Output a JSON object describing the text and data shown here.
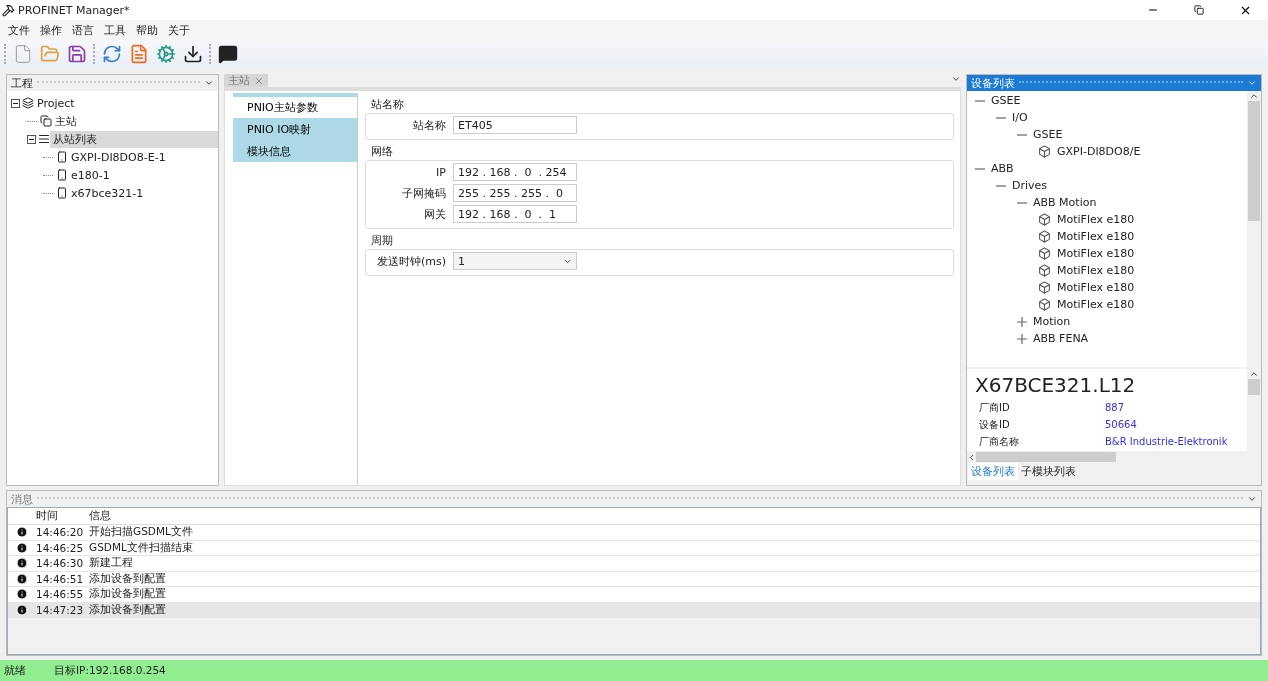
{
  "window": {
    "title": "PROFINET Manager*"
  },
  "menu": [
    "文件",
    "操作",
    "语言",
    "工具",
    "帮助",
    "关于"
  ],
  "project_panel": {
    "title": "工程",
    "tree": [
      {
        "label": "Project",
        "kind": "project",
        "expanded": true,
        "selected": false,
        "children": [
          {
            "label": "主站",
            "kind": "master",
            "selected": false
          },
          {
            "label": "从站列表",
            "kind": "list",
            "expanded": true,
            "selected": true,
            "children": [
              {
                "label": "GXPI-DI8DO8-E-1",
                "kind": "device",
                "selected": false
              },
              {
                "label": "e180-1",
                "kind": "device",
                "selected": false
              },
              {
                "label": "x67bce321-1",
                "kind": "device",
                "selected": false
              }
            ]
          }
        ]
      }
    ]
  },
  "document_tabs": [
    {
      "label": "主站",
      "selected": true
    }
  ],
  "side_nav": [
    {
      "label": "PNIO主站参数",
      "selected": true
    },
    {
      "label": "PNIO IO映射",
      "selected": false
    },
    {
      "label": "模块信息",
      "selected": false
    }
  ],
  "groups": [
    {
      "title": "站名称",
      "fields": [
        {
          "label": "站名称",
          "kind": "text",
          "value": "ET405"
        }
      ]
    },
    {
      "title": "网络",
      "fields": [
        {
          "label": "IP",
          "kind": "ip",
          "value": "192 . 168 .  0  . 254"
        },
        {
          "label": "子网掩码",
          "kind": "ip",
          "value": "255 . 255 . 255 .  0"
        },
        {
          "label": "网关",
          "kind": "ip",
          "value": "192 . 168 .  0  .  1"
        }
      ]
    },
    {
      "title": "周期",
      "fields": [
        {
          "label": "发送时钟(ms)",
          "kind": "select",
          "value": "1"
        }
      ]
    }
  ],
  "device_panel": {
    "title": "设备列表",
    "tree": [
      {
        "label": "GSEE",
        "expanded": true,
        "children": [
          {
            "label": "I/O",
            "expanded": true,
            "children": [
              {
                "label": "GSEE",
                "expanded": true,
                "children": [
                  {
                    "label": "GXPI-DI8DO8/E",
                    "kind": "device"
                  }
                ]
              }
            ]
          }
        ]
      },
      {
        "label": "ABB",
        "expanded": true,
        "children": [
          {
            "label": "Drives",
            "expanded": true,
            "children": [
              {
                "label": "ABB Motion",
                "expanded": true,
                "children": [
                  {
                    "label": "MotiFlex e180",
                    "kind": "device"
                  },
                  {
                    "label": "MotiFlex e180",
                    "kind": "device"
                  },
                  {
                    "label": "MotiFlex e180",
                    "kind": "device"
                  },
                  {
                    "label": "MotiFlex e180",
                    "kind": "device"
                  },
                  {
                    "label": "MotiFlex e180",
                    "kind": "device"
                  },
                  {
                    "label": "MotiFlex e180",
                    "kind": "device"
                  }
                ]
              },
              {
                "label": "Motion",
                "expanded": false
              },
              {
                "label": "ABB FENA",
                "expanded": false
              }
            ]
          }
        ]
      }
    ],
    "info": {
      "name": "X67BCE321.L12",
      "rows": [
        {
          "label": "厂商ID",
          "value": "887"
        },
        {
          "label": "设备ID",
          "value": "50664"
        },
        {
          "label": "厂商名称",
          "value": "B&R Industrie-Elektronik"
        }
      ]
    },
    "tabs": [
      {
        "label": "设备列表",
        "selected": true
      },
      {
        "label": "子模块列表",
        "selected": false
      }
    ]
  },
  "messages": {
    "title": "消息",
    "columns": [
      "时间",
      "信息"
    ],
    "rows": [
      {
        "time": "14:46:20",
        "text": "开始扫描GSDML文件",
        "selected": false
      },
      {
        "time": "14:46:25",
        "text": "GSDML文件扫描结束",
        "selected": false
      },
      {
        "time": "14:46:30",
        "text": "新建工程",
        "selected": false
      },
      {
        "time": "14:46:51",
        "text": "添加设备到配置",
        "selected": false
      },
      {
        "time": "14:46:55",
        "text": "添加设备到配置",
        "selected": false
      },
      {
        "time": "14:47:23",
        "text": "添加设备到配置",
        "selected": true
      }
    ]
  },
  "status_bar": [
    "就绪",
    "目标IP:192.168.0.254"
  ]
}
